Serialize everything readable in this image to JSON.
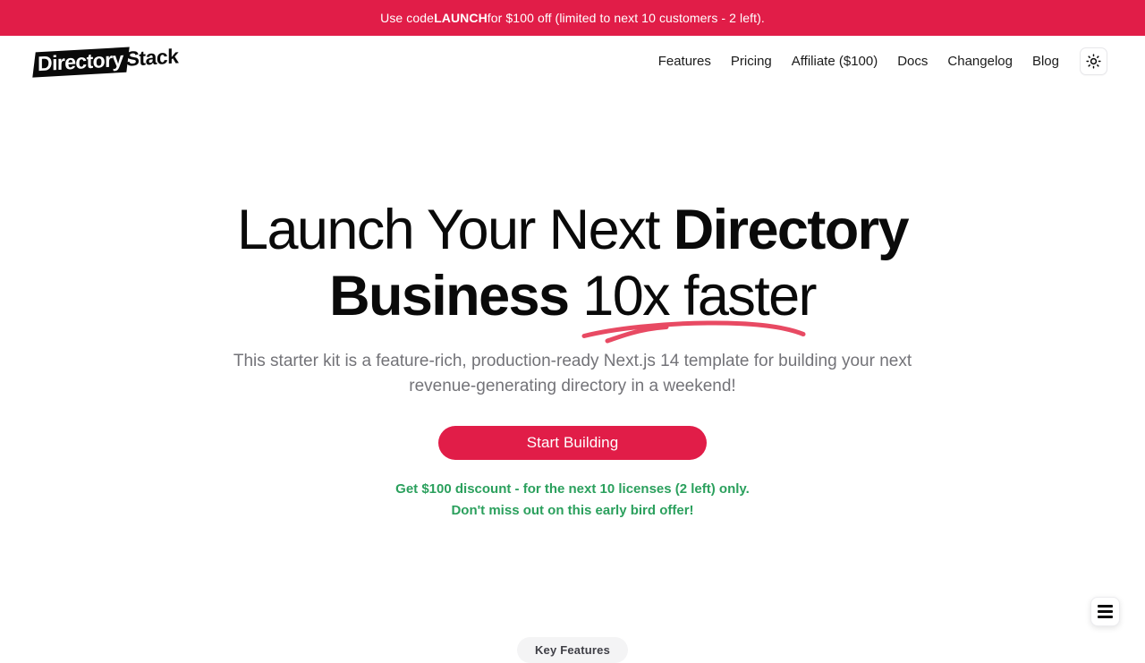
{
  "colors": {
    "brand": "#e11d48",
    "accent_green": "#2ba05d",
    "ink": "#0a0a0a",
    "muted": "#737378"
  },
  "announcement": {
    "lead": "Use code ",
    "code": "LAUNCH",
    "tail": " for $100 off (limited to next 10 customers - 2 left)."
  },
  "header": {
    "logo": {
      "mark": "Directory",
      "word": "Stack"
    },
    "nav": [
      {
        "label": "Features"
      },
      {
        "label": "Pricing"
      },
      {
        "label": "Affiliate ($100)"
      },
      {
        "label": "Docs"
      },
      {
        "label": "Changelog"
      },
      {
        "label": "Blog"
      }
    ],
    "theme_toggle_icon": "sun-icon"
  },
  "hero": {
    "title_line1_regular": "Launch Your Next ",
    "title_line1_bold": "Directory",
    "title_line2_bold": "Business ",
    "title_line2_regular": "10x faster",
    "subtitle": "This starter kit is a feature-rich, production-ready Next.js 14 template for building your next revenue-generating directory in a weekend!",
    "cta_label": "Start Building",
    "discount_line1": "Get $100 discount - for the next 10 licenses (2 left) only.",
    "discount_line2": "Don't miss out on this early bird offer!"
  },
  "next_section": {
    "pill_label": "Key Features"
  },
  "floating": {
    "menu_icon": "hamburger-menu-icon"
  }
}
